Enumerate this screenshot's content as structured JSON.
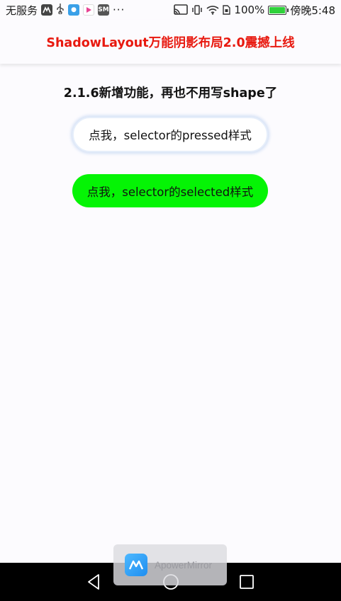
{
  "status_bar": {
    "carrier": "无服务",
    "overflow": "···",
    "battery_percent": "100%",
    "time": "傍晚5:48",
    "icons": [
      "app-icon-mirror",
      "usb-icon",
      "app-icon-assistant",
      "app-icon-video",
      "app-icon-shop",
      "cast-icon",
      "vibrate-icon",
      "wifi-icon",
      "sim-icon",
      "battery-icon"
    ],
    "battery_color": "#2fd13a"
  },
  "toolbar": {
    "title": "ShadowLayout万能阴影布局2.0震撼上线",
    "title_color": "#e8190f"
  },
  "content": {
    "heading": "2.1.6新增功能，再也不用写shape了",
    "pressed_button_label": "点我，selector的pressed样式",
    "selected_button_label": "点我，selector的selected样式",
    "selected_button_color": "#05f405"
  },
  "overlay": {
    "app_name": "ApowerMirror"
  },
  "nav_bar": {
    "icons": [
      "back-icon",
      "home-icon",
      "recents-icon"
    ]
  }
}
